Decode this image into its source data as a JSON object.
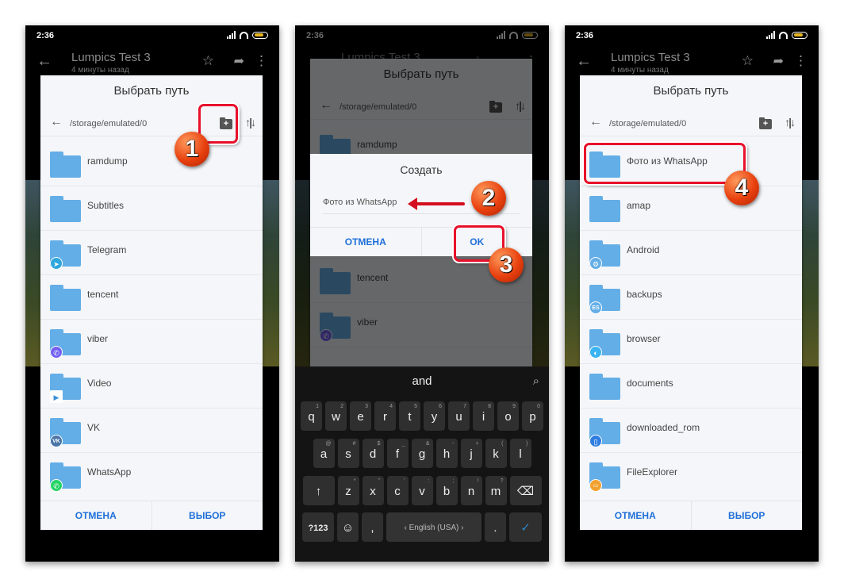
{
  "status": {
    "time": "2:36"
  },
  "appbar": {
    "title": "Lumpics Test 3",
    "subtitle": "4 минуты назад",
    "back_icon": "←",
    "star_icon": "☆",
    "share_icon": "➦",
    "more_icon": "⋮"
  },
  "dialog": {
    "title": "Выбрать путь",
    "path": "/storage/emulated/0",
    "back_icon": "←",
    "new_folder_icon": "+",
    "sort_icon": "↑|↓",
    "cancel_label": "ОТМЕНА",
    "select_label": "ВЫБОР"
  },
  "screen1_folders": [
    {
      "name": "ramdump",
      "badge": ""
    },
    {
      "name": "Subtitles",
      "badge": ""
    },
    {
      "name": "Telegram",
      "badge": "telegram"
    },
    {
      "name": "tencent",
      "badge": ""
    },
    {
      "name": "viber",
      "badge": "viber"
    },
    {
      "name": "Video",
      "badge": "video"
    },
    {
      "name": "VK",
      "badge": "vk"
    },
    {
      "name": "WhatsApp",
      "badge": "whatsapp"
    }
  ],
  "screen2_folders": [
    {
      "name": "ramdump"
    },
    {
      "name": "tencent"
    },
    {
      "name": "viber"
    }
  ],
  "create_dialog": {
    "title": "Создать",
    "input_value": "Фото из WhatsApp",
    "cancel_label": "ОТМЕНА",
    "ok_label": "OK"
  },
  "keyboard": {
    "suggestion": "and",
    "search_icon": "⌕",
    "row1": [
      "q",
      "w",
      "e",
      "r",
      "t",
      "y",
      "u",
      "i",
      "o",
      "p"
    ],
    "row1_hints": [
      "1",
      "2",
      "3",
      "4",
      "5",
      "6",
      "7",
      "8",
      "9",
      "0"
    ],
    "row2": [
      "a",
      "s",
      "d",
      "f",
      "g",
      "h",
      "j",
      "k",
      "l"
    ],
    "row2_hints": [
      "@",
      "#",
      "$",
      "_",
      "&",
      "-",
      "+",
      "(",
      ")"
    ],
    "row3": [
      "z",
      "x",
      "c",
      "v",
      "b",
      "n",
      "m"
    ],
    "row3_hints": [
      "*",
      "\"",
      "'",
      ":",
      ";",
      "!",
      "?"
    ],
    "shift": "↑",
    "backspace": "⌫",
    "symbols": "?123",
    "emoji": "☺",
    "comma": ",",
    "space": "‹ English (USA) ›",
    "period": ".",
    "enter": "✓"
  },
  "screen3_folders": [
    {
      "name": "Фото из WhatsApp",
      "badge": ""
    },
    {
      "name": "amap",
      "badge": ""
    },
    {
      "name": "Android",
      "badge": "android"
    },
    {
      "name": "backups",
      "badge": "es"
    },
    {
      "name": "browser",
      "badge": "browser"
    },
    {
      "name": "documents",
      "badge": ""
    },
    {
      "name": "downloaded_rom",
      "badge": "rom"
    },
    {
      "name": "FileExplorer",
      "badge": "fileexplorer"
    }
  ],
  "steps": [
    "1",
    "2",
    "3",
    "4"
  ],
  "colors": {
    "accent": "#1e6fd9",
    "folder": "#64aee7",
    "callout": "#e8102a"
  }
}
